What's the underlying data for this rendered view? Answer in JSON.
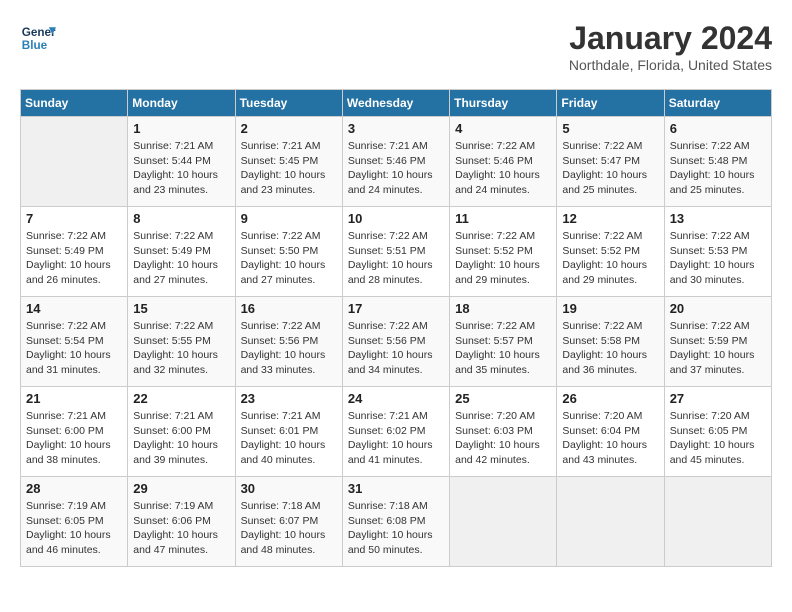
{
  "header": {
    "logo_line1": "General",
    "logo_line2": "Blue",
    "month": "January 2024",
    "location": "Northdale, Florida, United States"
  },
  "days_of_week": [
    "Sunday",
    "Monday",
    "Tuesday",
    "Wednesday",
    "Thursday",
    "Friday",
    "Saturday"
  ],
  "weeks": [
    [
      {
        "day": "",
        "info": ""
      },
      {
        "day": "1",
        "info": "Sunrise: 7:21 AM\nSunset: 5:44 PM\nDaylight: 10 hours\nand 23 minutes."
      },
      {
        "day": "2",
        "info": "Sunrise: 7:21 AM\nSunset: 5:45 PM\nDaylight: 10 hours\nand 23 minutes."
      },
      {
        "day": "3",
        "info": "Sunrise: 7:21 AM\nSunset: 5:46 PM\nDaylight: 10 hours\nand 24 minutes."
      },
      {
        "day": "4",
        "info": "Sunrise: 7:22 AM\nSunset: 5:46 PM\nDaylight: 10 hours\nand 24 minutes."
      },
      {
        "day": "5",
        "info": "Sunrise: 7:22 AM\nSunset: 5:47 PM\nDaylight: 10 hours\nand 25 minutes."
      },
      {
        "day": "6",
        "info": "Sunrise: 7:22 AM\nSunset: 5:48 PM\nDaylight: 10 hours\nand 25 minutes."
      }
    ],
    [
      {
        "day": "7",
        "info": "Sunrise: 7:22 AM\nSunset: 5:49 PM\nDaylight: 10 hours\nand 26 minutes."
      },
      {
        "day": "8",
        "info": "Sunrise: 7:22 AM\nSunset: 5:49 PM\nDaylight: 10 hours\nand 27 minutes."
      },
      {
        "day": "9",
        "info": "Sunrise: 7:22 AM\nSunset: 5:50 PM\nDaylight: 10 hours\nand 27 minutes."
      },
      {
        "day": "10",
        "info": "Sunrise: 7:22 AM\nSunset: 5:51 PM\nDaylight: 10 hours\nand 28 minutes."
      },
      {
        "day": "11",
        "info": "Sunrise: 7:22 AM\nSunset: 5:52 PM\nDaylight: 10 hours\nand 29 minutes."
      },
      {
        "day": "12",
        "info": "Sunrise: 7:22 AM\nSunset: 5:52 PM\nDaylight: 10 hours\nand 29 minutes."
      },
      {
        "day": "13",
        "info": "Sunrise: 7:22 AM\nSunset: 5:53 PM\nDaylight: 10 hours\nand 30 minutes."
      }
    ],
    [
      {
        "day": "14",
        "info": "Sunrise: 7:22 AM\nSunset: 5:54 PM\nDaylight: 10 hours\nand 31 minutes."
      },
      {
        "day": "15",
        "info": "Sunrise: 7:22 AM\nSunset: 5:55 PM\nDaylight: 10 hours\nand 32 minutes."
      },
      {
        "day": "16",
        "info": "Sunrise: 7:22 AM\nSunset: 5:56 PM\nDaylight: 10 hours\nand 33 minutes."
      },
      {
        "day": "17",
        "info": "Sunrise: 7:22 AM\nSunset: 5:56 PM\nDaylight: 10 hours\nand 34 minutes."
      },
      {
        "day": "18",
        "info": "Sunrise: 7:22 AM\nSunset: 5:57 PM\nDaylight: 10 hours\nand 35 minutes."
      },
      {
        "day": "19",
        "info": "Sunrise: 7:22 AM\nSunset: 5:58 PM\nDaylight: 10 hours\nand 36 minutes."
      },
      {
        "day": "20",
        "info": "Sunrise: 7:22 AM\nSunset: 5:59 PM\nDaylight: 10 hours\nand 37 minutes."
      }
    ],
    [
      {
        "day": "21",
        "info": "Sunrise: 7:21 AM\nSunset: 6:00 PM\nDaylight: 10 hours\nand 38 minutes."
      },
      {
        "day": "22",
        "info": "Sunrise: 7:21 AM\nSunset: 6:00 PM\nDaylight: 10 hours\nand 39 minutes."
      },
      {
        "day": "23",
        "info": "Sunrise: 7:21 AM\nSunset: 6:01 PM\nDaylight: 10 hours\nand 40 minutes."
      },
      {
        "day": "24",
        "info": "Sunrise: 7:21 AM\nSunset: 6:02 PM\nDaylight: 10 hours\nand 41 minutes."
      },
      {
        "day": "25",
        "info": "Sunrise: 7:20 AM\nSunset: 6:03 PM\nDaylight: 10 hours\nand 42 minutes."
      },
      {
        "day": "26",
        "info": "Sunrise: 7:20 AM\nSunset: 6:04 PM\nDaylight: 10 hours\nand 43 minutes."
      },
      {
        "day": "27",
        "info": "Sunrise: 7:20 AM\nSunset: 6:05 PM\nDaylight: 10 hours\nand 45 minutes."
      }
    ],
    [
      {
        "day": "28",
        "info": "Sunrise: 7:19 AM\nSunset: 6:05 PM\nDaylight: 10 hours\nand 46 minutes."
      },
      {
        "day": "29",
        "info": "Sunrise: 7:19 AM\nSunset: 6:06 PM\nDaylight: 10 hours\nand 47 minutes."
      },
      {
        "day": "30",
        "info": "Sunrise: 7:18 AM\nSunset: 6:07 PM\nDaylight: 10 hours\nand 48 minutes."
      },
      {
        "day": "31",
        "info": "Sunrise: 7:18 AM\nSunset: 6:08 PM\nDaylight: 10 hours\nand 50 minutes."
      },
      {
        "day": "",
        "info": ""
      },
      {
        "day": "",
        "info": ""
      },
      {
        "day": "",
        "info": ""
      }
    ]
  ]
}
